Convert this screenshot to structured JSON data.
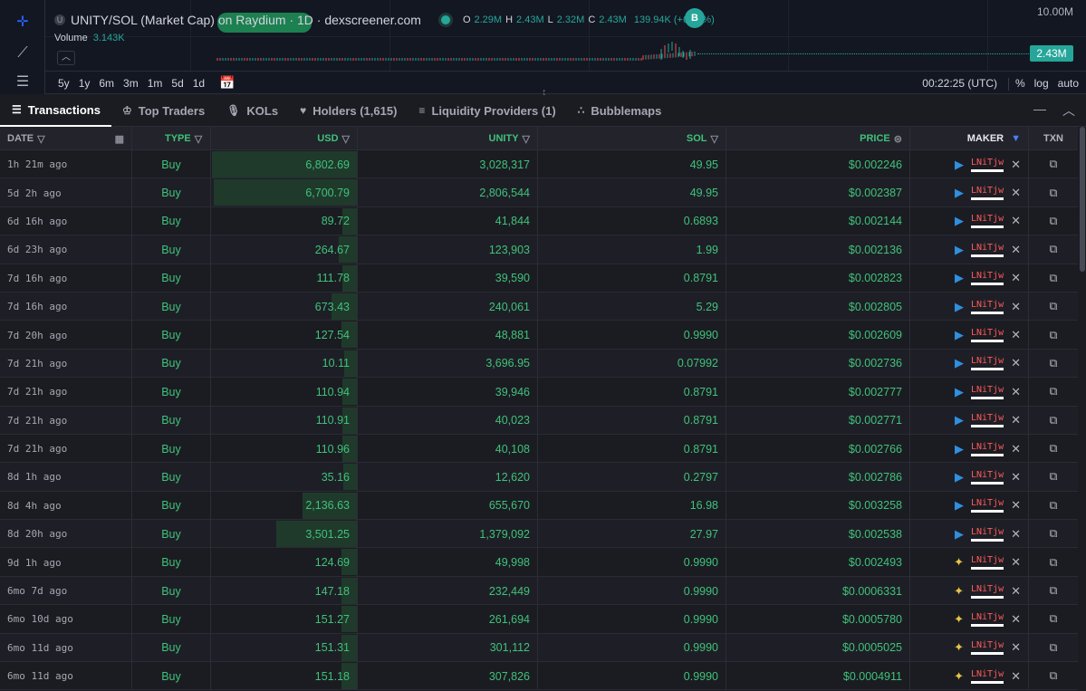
{
  "chart": {
    "pair_title": "UNITY/SOL (Market Cap) on Raydium · 1D · dexscreener.com",
    "badge": "U",
    "buy_marker": "B",
    "ohlc": [
      {
        "k": "O",
        "v": "2.29M"
      },
      {
        "k": "H",
        "v": "2.43M"
      },
      {
        "k": "L",
        "v": "2.32M"
      },
      {
        "k": "C",
        "v": "2.43M"
      },
      {
        "k": "",
        "v": "139.94K (+6.09%)"
      }
    ],
    "volume_label": "Volume",
    "volume_value": "3.143K",
    "scale_top": "10.00M",
    "last_price": "2.43M",
    "ranges": [
      "5y",
      "1y",
      "6m",
      "3m",
      "1m",
      "5d",
      "1d"
    ],
    "time_utc": "00:22:25 (UTC)",
    "scale_options": [
      "%",
      "log",
      "auto"
    ],
    "colors": {
      "up": "#26a69a",
      "down": "#ef5350",
      "background": "#131722"
    }
  },
  "tabs": [
    {
      "label": "Transactions",
      "icon": "list-icon",
      "glyph": "☰",
      "active": true
    },
    {
      "label": "Top Traders",
      "icon": "trophy-icon",
      "glyph": "♔",
      "active": false
    },
    {
      "label": "KOLs",
      "icon": "microphone-icon",
      "glyph": "🎙",
      "active": false
    },
    {
      "label": "Holders (1,615)",
      "icon": "heart-icon",
      "glyph": "♥",
      "active": false
    },
    {
      "label": "Liquidity Providers (1)",
      "icon": "layers-icon",
      "glyph": "≡",
      "active": false
    },
    {
      "label": "Bubblemaps",
      "icon": "bubbles-icon",
      "glyph": "∴",
      "active": false
    }
  ],
  "table": {
    "headers": {
      "date": "DATE",
      "type": "TYPE",
      "usd": "USD",
      "unity": "UNITY",
      "sol": "SOL",
      "price": "PRICE",
      "maker": "MAKER",
      "txn": "TXN"
    },
    "colors": {
      "buy": "#3fc27a",
      "maker_id": "#ff5a5a",
      "bar": "#1f3a2b"
    },
    "usd_bar_max": 6802.69,
    "rows": [
      {
        "date": "1h 21m ago",
        "type": "Buy",
        "usd": "6,802.69",
        "usd_value": 6802.69,
        "unity": "3,028,317",
        "sol": "49.95",
        "price": "$0.002246",
        "maker": "LNiTjw",
        "maker_icon": "whale"
      },
      {
        "date": "5d 2h ago",
        "type": "Buy",
        "usd": "6,700.79",
        "usd_value": 6700.79,
        "unity": "2,806,544",
        "sol": "49.95",
        "price": "$0.002387",
        "maker": "LNiTjw",
        "maker_icon": "whale"
      },
      {
        "date": "6d 16h ago",
        "type": "Buy",
        "usd": "89.72",
        "usd_value": 89.72,
        "unity": "41,844",
        "sol": "0.6893",
        "price": "$0.002144",
        "maker": "LNiTjw",
        "maker_icon": "whale"
      },
      {
        "date": "6d 23h ago",
        "type": "Buy",
        "usd": "264.67",
        "usd_value": 264.67,
        "unity": "123,903",
        "sol": "1.99",
        "price": "$0.002136",
        "maker": "LNiTjw",
        "maker_icon": "whale"
      },
      {
        "date": "7d 16h ago",
        "type": "Buy",
        "usd": "111.78",
        "usd_value": 111.78,
        "unity": "39,590",
        "sol": "0.8791",
        "price": "$0.002823",
        "maker": "LNiTjw",
        "maker_icon": "whale"
      },
      {
        "date": "7d 16h ago",
        "type": "Buy",
        "usd": "673.43",
        "usd_value": 673.43,
        "unity": "240,061",
        "sol": "5.29",
        "price": "$0.002805",
        "maker": "LNiTjw",
        "maker_icon": "whale"
      },
      {
        "date": "7d 20h ago",
        "type": "Buy",
        "usd": "127.54",
        "usd_value": 127.54,
        "unity": "48,881",
        "sol": "0.9990",
        "price": "$0.002609",
        "maker": "LNiTjw",
        "maker_icon": "whale"
      },
      {
        "date": "7d 21h ago",
        "type": "Buy",
        "usd": "10.11",
        "usd_value": 10.11,
        "unity": "3,696.95",
        "sol": "0.07992",
        "price": "$0.002736",
        "maker": "LNiTjw",
        "maker_icon": "whale"
      },
      {
        "date": "7d 21h ago",
        "type": "Buy",
        "usd": "110.94",
        "usd_value": 110.94,
        "unity": "39,946",
        "sol": "0.8791",
        "price": "$0.002777",
        "maker": "LNiTjw",
        "maker_icon": "whale"
      },
      {
        "date": "7d 21h ago",
        "type": "Buy",
        "usd": "110.91",
        "usd_value": 110.91,
        "unity": "40,023",
        "sol": "0.8791",
        "price": "$0.002771",
        "maker": "LNiTjw",
        "maker_icon": "whale"
      },
      {
        "date": "7d 21h ago",
        "type": "Buy",
        "usd": "110.96",
        "usd_value": 110.96,
        "unity": "40,108",
        "sol": "0.8791",
        "price": "$0.002766",
        "maker": "LNiTjw",
        "maker_icon": "whale"
      },
      {
        "date": "8d 1h ago",
        "type": "Buy",
        "usd": "35.16",
        "usd_value": 35.16,
        "unity": "12,620",
        "sol": "0.2797",
        "price": "$0.002786",
        "maker": "LNiTjw",
        "maker_icon": "whale"
      },
      {
        "date": "8d 4h ago",
        "type": "Buy",
        "usd": "2,136.63",
        "usd_value": 2136.63,
        "unity": "655,670",
        "sol": "16.98",
        "price": "$0.003258",
        "maker": "LNiTjw",
        "maker_icon": "whale"
      },
      {
        "date": "8d 20h ago",
        "type": "Buy",
        "usd": "3,501.25",
        "usd_value": 3501.25,
        "unity": "1,379,092",
        "sol": "27.97",
        "price": "$0.002538",
        "maker": "LNiTjw",
        "maker_icon": "whale"
      },
      {
        "date": "9d 1h ago",
        "type": "Buy",
        "usd": "124.69",
        "usd_value": 124.69,
        "unity": "49,998",
        "sol": "0.9990",
        "price": "$0.002493",
        "maker": "LNiTjw",
        "maker_icon": "whale-star"
      },
      {
        "date": "6mo 7d ago",
        "type": "Buy",
        "usd": "147.18",
        "usd_value": 147.18,
        "unity": "232,449",
        "sol": "0.9990",
        "price": "$0.0006331",
        "maker": "LNiTjw",
        "maker_icon": "whale-star"
      },
      {
        "date": "6mo 10d ago",
        "type": "Buy",
        "usd": "151.27",
        "usd_value": 151.27,
        "unity": "261,694",
        "sol": "0.9990",
        "price": "$0.0005780",
        "maker": "LNiTjw",
        "maker_icon": "whale-star"
      },
      {
        "date": "6mo 11d ago",
        "type": "Buy",
        "usd": "151.31",
        "usd_value": 151.31,
        "unity": "301,112",
        "sol": "0.9990",
        "price": "$0.0005025",
        "maker": "LNiTjw",
        "maker_icon": "whale-star"
      },
      {
        "date": "6mo 11d ago",
        "type": "Buy",
        "usd": "151.18",
        "usd_value": 151.18,
        "unity": "307,826",
        "sol": "0.9990",
        "price": "$0.0004911",
        "maker": "LNiTjw",
        "maker_icon": "whale-star"
      }
    ]
  }
}
